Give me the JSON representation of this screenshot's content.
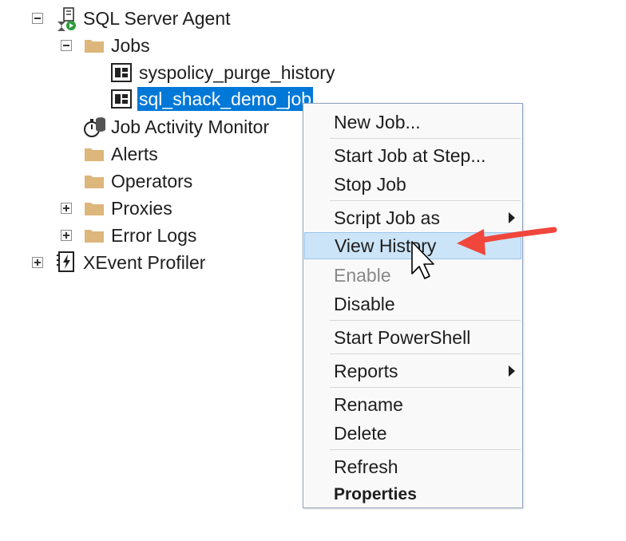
{
  "tree": {
    "sql_server_agent": "SQL Server Agent",
    "jobs": "Jobs",
    "job_1": "syspolicy_purge_history",
    "job_2": "sql_shack_demo_job",
    "job_activity_monitor": "Job Activity Monitor",
    "alerts": "Alerts",
    "operators": "Operators",
    "proxies": "Proxies",
    "error_logs": "Error Logs",
    "xevent_profiler": "XEvent Profiler"
  },
  "context_menu": {
    "new_job": "New Job...",
    "start_job_at_step": "Start Job at Step...",
    "stop_job": "Stop Job",
    "script_job_as": "Script Job as",
    "view_history": "View History",
    "enable": "Enable",
    "disable": "Disable",
    "start_powershell": "Start PowerShell",
    "reports": "Reports",
    "rename": "Rename",
    "delete": "Delete",
    "refresh": "Refresh",
    "properties": "Properties"
  },
  "colors": {
    "selection": "#0078d7",
    "menu_highlight": "#cce4f7",
    "annotation_arrow": "#f0463c",
    "folder": "#dcb67a"
  },
  "icons": [
    "agent-icon",
    "folder-icon",
    "job-icon",
    "stopwatch-icon",
    "xevent-icon",
    "cursor-icon"
  ]
}
